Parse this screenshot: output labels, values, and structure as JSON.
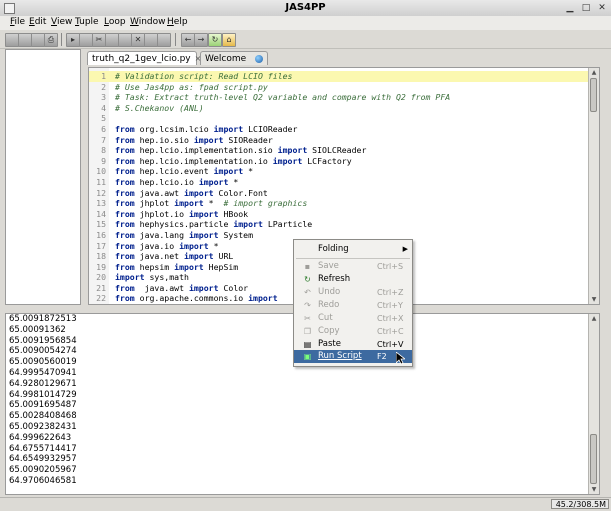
{
  "window": {
    "title": "JAS4PP"
  },
  "menu": [
    "File",
    "Edit",
    "View",
    "Tuple",
    "Loop",
    "Window",
    "Help"
  ],
  "tabs": [
    {
      "label": "truth_q2_1gev_lcio.py",
      "close": "×"
    },
    {
      "label": "Welcome",
      "close": ""
    }
  ],
  "editor": {
    "lines": [
      {
        "n": "1",
        "parts": [
          {
            "t": "# Validation script: Read LCIO files",
            "c": "cm"
          }
        ]
      },
      {
        "n": "2",
        "parts": [
          {
            "t": "# Use Jas4pp as: fpad script.py",
            "c": "cm"
          }
        ]
      },
      {
        "n": "3",
        "parts": [
          {
            "t": "# Task: Extract truth-level Q2 variable and compare with Q2 from PFA",
            "c": "cm"
          }
        ]
      },
      {
        "n": "4",
        "parts": [
          {
            "t": "# S.Chekanov (ANL)",
            "c": "cm"
          }
        ]
      },
      {
        "n": "5",
        "parts": []
      },
      {
        "n": "6",
        "parts": [
          {
            "t": "from",
            "c": "kw"
          },
          {
            "t": " org.lcsim.lcio ",
            "c": ""
          },
          {
            "t": "import",
            "c": "kw"
          },
          {
            "t": " LCIOReader",
            "c": ""
          }
        ]
      },
      {
        "n": "7",
        "parts": [
          {
            "t": "from",
            "c": "kw"
          },
          {
            "t": " hep.io.sio ",
            "c": ""
          },
          {
            "t": "import",
            "c": "kw"
          },
          {
            "t": " SIOReader",
            "c": ""
          }
        ]
      },
      {
        "n": "8",
        "parts": [
          {
            "t": "from",
            "c": "kw"
          },
          {
            "t": " hep.lcio.implementation.sio ",
            "c": ""
          },
          {
            "t": "import",
            "c": "kw"
          },
          {
            "t": " SIOLCReader",
            "c": ""
          }
        ]
      },
      {
        "n": "9",
        "parts": [
          {
            "t": "from",
            "c": "kw"
          },
          {
            "t": " hep.lcio.implementation.io ",
            "c": ""
          },
          {
            "t": "import",
            "c": "kw"
          },
          {
            "t": " LCFactory",
            "c": ""
          }
        ]
      },
      {
        "n": "10",
        "parts": [
          {
            "t": "from",
            "c": "kw"
          },
          {
            "t": " hep.lcio.event ",
            "c": ""
          },
          {
            "t": "import",
            "c": "kw"
          },
          {
            "t": " *",
            "c": ""
          }
        ]
      },
      {
        "n": "11",
        "parts": [
          {
            "t": "from",
            "c": "kw"
          },
          {
            "t": " hep.lcio.io ",
            "c": ""
          },
          {
            "t": "import",
            "c": "kw"
          },
          {
            "t": " *",
            "c": ""
          }
        ]
      },
      {
        "n": "12",
        "parts": [
          {
            "t": "from",
            "c": "kw"
          },
          {
            "t": " java.awt ",
            "c": ""
          },
          {
            "t": "import",
            "c": "kw"
          },
          {
            "t": " Color.Font",
            "c": ""
          }
        ]
      },
      {
        "n": "13",
        "parts": [
          {
            "t": "from",
            "c": "kw"
          },
          {
            "t": " jhplot ",
            "c": ""
          },
          {
            "t": "import",
            "c": "kw"
          },
          {
            "t": " *  ",
            "c": ""
          },
          {
            "t": "# import graphics",
            "c": "cm"
          }
        ]
      },
      {
        "n": "14",
        "parts": [
          {
            "t": "from",
            "c": "kw"
          },
          {
            "t": " jhplot.io ",
            "c": ""
          },
          {
            "t": "import",
            "c": "kw"
          },
          {
            "t": " HBook",
            "c": ""
          }
        ]
      },
      {
        "n": "15",
        "parts": [
          {
            "t": "from",
            "c": "kw"
          },
          {
            "t": " hephysics.particle ",
            "c": ""
          },
          {
            "t": "import",
            "c": "kw"
          },
          {
            "t": " LParticle",
            "c": ""
          }
        ]
      },
      {
        "n": "16",
        "parts": [
          {
            "t": "from",
            "c": "kw"
          },
          {
            "t": " java.lang ",
            "c": ""
          },
          {
            "t": "import",
            "c": "kw"
          },
          {
            "t": " System",
            "c": ""
          }
        ]
      },
      {
        "n": "17",
        "parts": [
          {
            "t": "from",
            "c": "kw"
          },
          {
            "t": " java.io ",
            "c": ""
          },
          {
            "t": "import",
            "c": "kw"
          },
          {
            "t": " *",
            "c": ""
          }
        ]
      },
      {
        "n": "18",
        "parts": [
          {
            "t": "from",
            "c": "kw"
          },
          {
            "t": " java.net ",
            "c": ""
          },
          {
            "t": "import",
            "c": "kw"
          },
          {
            "t": " URL",
            "c": ""
          }
        ]
      },
      {
        "n": "19",
        "parts": [
          {
            "t": "from",
            "c": "kw"
          },
          {
            "t": " hepsim ",
            "c": ""
          },
          {
            "t": "import",
            "c": "kw"
          },
          {
            "t": " HepSim",
            "c": ""
          }
        ]
      },
      {
        "n": "20",
        "parts": [
          {
            "t": "import",
            "c": "kw"
          },
          {
            "t": " sys,math",
            "c": ""
          }
        ]
      },
      {
        "n": "21",
        "parts": [
          {
            "t": "from",
            "c": "kw"
          },
          {
            "t": "  java.awt ",
            "c": ""
          },
          {
            "t": "import",
            "c": "kw"
          },
          {
            "t": " Color",
            "c": ""
          }
        ]
      },
      {
        "n": "22",
        "parts": [
          {
            "t": "from",
            "c": "kw"
          },
          {
            "t": " org.apache.commons.io ",
            "c": ""
          },
          {
            "t": "import",
            "c": "kw"
          },
          {
            "t": " ",
            "c": ""
          }
        ]
      }
    ]
  },
  "output": {
    "lines": [
      "65.0091872513",
      "65.00091362",
      "65.0091956854",
      "65.0090054274",
      "65.0090560019",
      "64.9995470941",
      "64.9280129671",
      "64.9981014729",
      "65.0091695487",
      "65.0028408468",
      "65.0092382431",
      "64.999622643",
      "64.6755714417",
      "64.6549932957",
      "65.0090205967",
      "64.9706046581"
    ]
  },
  "context_menu": {
    "items": [
      {
        "label": "Folding",
        "accel": "",
        "enabled": true,
        "submenu": true,
        "icon": ""
      },
      {
        "label": "Save",
        "accel": "Ctrl+S",
        "enabled": false,
        "icon": "save-icon"
      },
      {
        "label": "Refresh",
        "accel": "",
        "enabled": true,
        "icon": "refresh-icon"
      },
      {
        "label": "Undo",
        "accel": "Ctrl+Z",
        "enabled": false,
        "icon": "undo-icon"
      },
      {
        "label": "Redo",
        "accel": "Ctrl+Y",
        "enabled": false,
        "icon": "redo-icon"
      },
      {
        "label": "Cut",
        "accel": "Ctrl+X",
        "enabled": false,
        "icon": "cut-icon"
      },
      {
        "label": "Copy",
        "accel": "Ctrl+C",
        "enabled": false,
        "icon": "copy-icon"
      },
      {
        "label": "Paste",
        "accel": "Ctrl+V",
        "enabled": true,
        "icon": "paste-icon"
      },
      {
        "label": "Run Script",
        "accel": "F2",
        "enabled": true,
        "selected": true,
        "icon": "run-script-icon"
      }
    ]
  },
  "status": {
    "memory": "45.2/308.5M"
  },
  "colors": {
    "highlight_line": "#fbf8b0",
    "keyword": "#00208e",
    "comment": "#3b6e3b",
    "menu_selection": "#3d6aa0"
  }
}
